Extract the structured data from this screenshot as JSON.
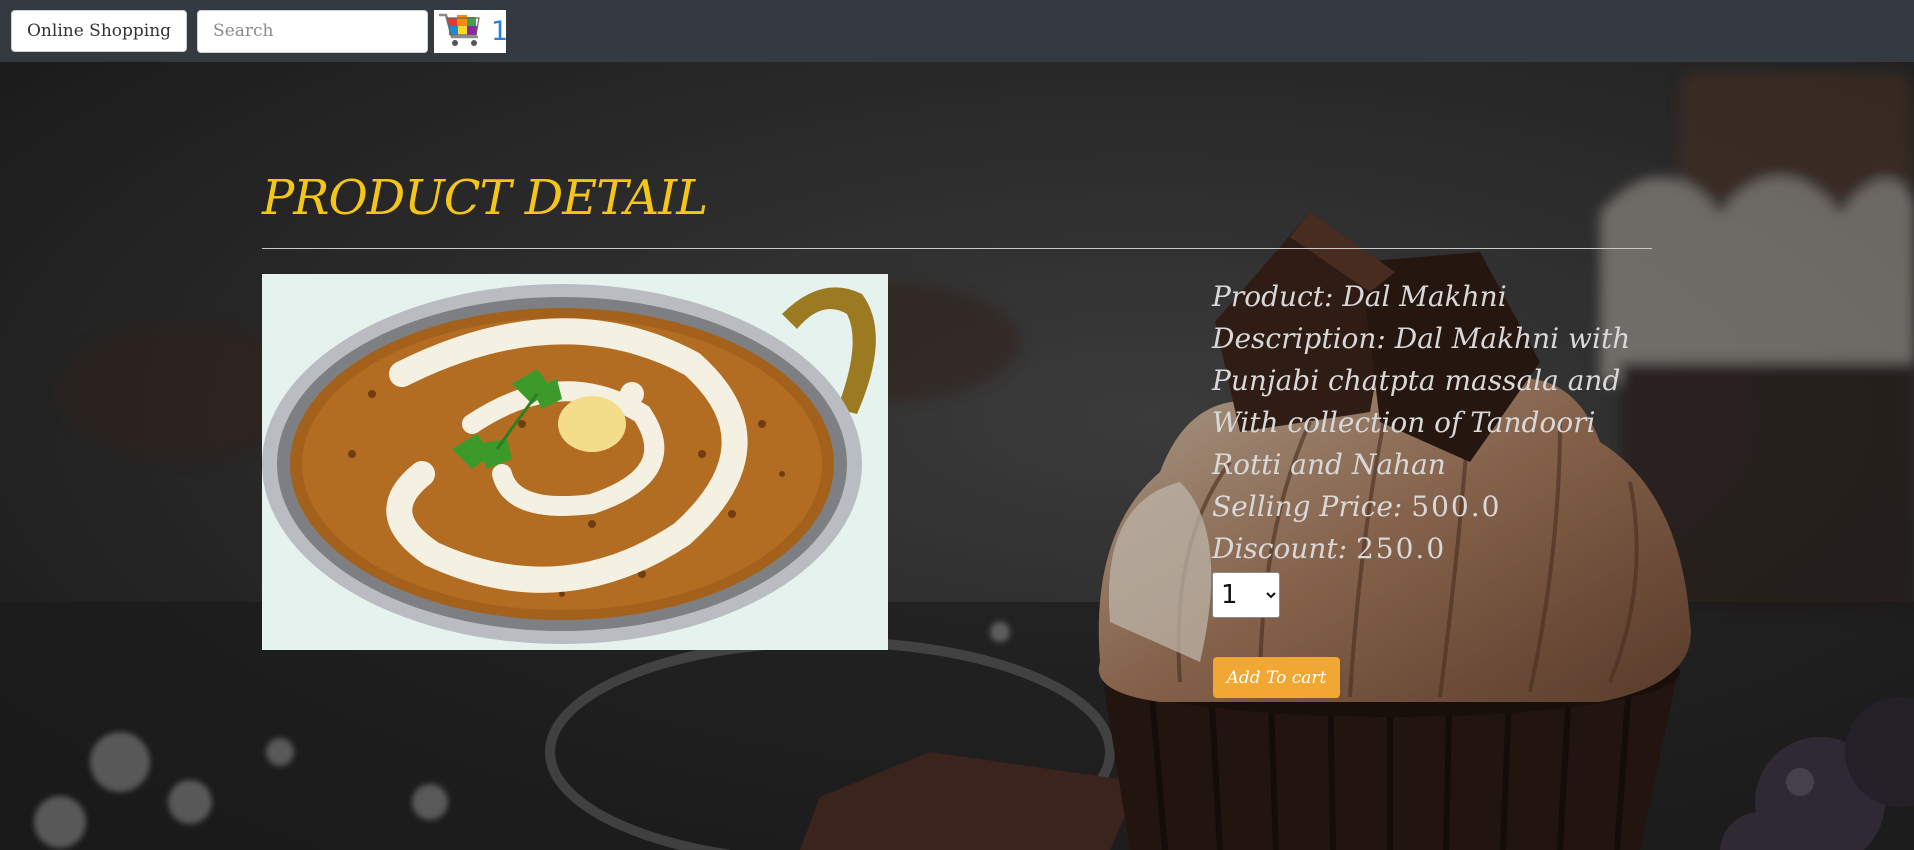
{
  "navbar": {
    "brand_label": "Online Shopping",
    "search_placeholder": "Search",
    "cart_icon": "shopping-cart-icon",
    "cart_count": "1"
  },
  "page": {
    "title": "PRODUCT DETAIL"
  },
  "product": {
    "image_icon": "dal-makhni-dish-image",
    "name_label": "Product: ",
    "name": "Dal Makhni",
    "description_label": "Description: ",
    "description": "Dal Makhni with Punjabi chatpta massala and With collection of Tandoori Rotti and Nahan",
    "price_label": "Selling Price: ",
    "price": "500.0",
    "discount_label": "Discount: ",
    "discount": "250.0"
  },
  "quantity": {
    "selected": "1",
    "options": [
      "1"
    ]
  },
  "actions": {
    "add_to_cart_label": "Add To cart"
  },
  "colors": {
    "navbar_bg": "#343a40",
    "title": "#f5c518",
    "button": "#f0a733",
    "cart_count": "#2b7fd4"
  }
}
